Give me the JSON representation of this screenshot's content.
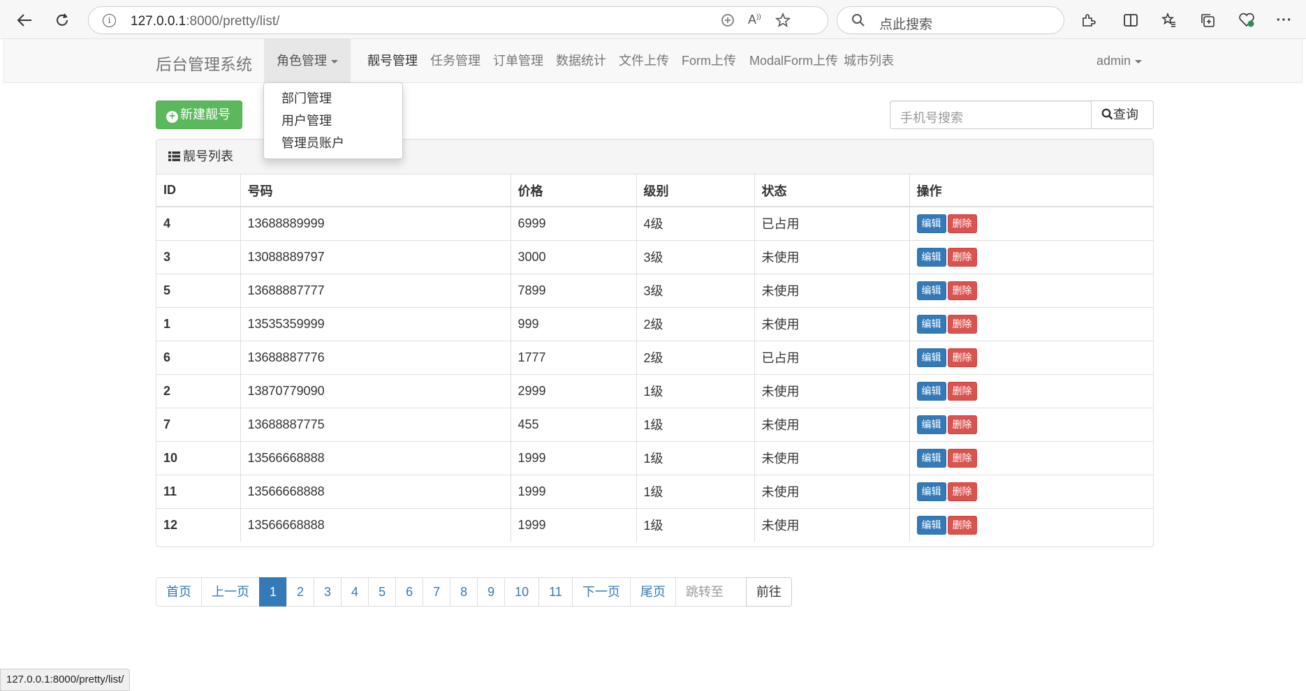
{
  "browser": {
    "url_host": "127.0.0.1",
    "url_rest": ":8000/pretty/list/",
    "search_placeholder": "点此搜索"
  },
  "navbar": {
    "brand": "后台管理系统",
    "items": [
      "角色管理",
      "靓号管理",
      "任务管理",
      "订单管理",
      "数据统计",
      "文件上传",
      "Form上传",
      "ModalForm上传",
      "城市列表"
    ],
    "user": "admin"
  },
  "dropdown": {
    "items": [
      "部门管理",
      "用户管理",
      "管理员账户"
    ]
  },
  "toolbar": {
    "new_button": "新建靓号",
    "search_placeholder": "手机号搜索",
    "search_button": "查询"
  },
  "panel": {
    "title": "靓号列表"
  },
  "table": {
    "headers": [
      "ID",
      "号码",
      "价格",
      "级别",
      "状态",
      "操作"
    ],
    "edit_label": "编辑",
    "delete_label": "删除",
    "rows": [
      [
        "4",
        "13688889999",
        "6999",
        "4级",
        "已占用"
      ],
      [
        "3",
        "13088889797",
        "3000",
        "3级",
        "未使用"
      ],
      [
        "5",
        "13688887777",
        "7899",
        "3级",
        "未使用"
      ],
      [
        "1",
        "13535359999",
        "999",
        "2级",
        "未使用"
      ],
      [
        "6",
        "13688887776",
        "1777",
        "2级",
        "已占用"
      ],
      [
        "2",
        "13870779090",
        "2999",
        "1级",
        "未使用"
      ],
      [
        "7",
        "13688887775",
        "455",
        "1级",
        "未使用"
      ],
      [
        "10",
        "13566668888",
        "1999",
        "1级",
        "未使用"
      ],
      [
        "11",
        "13566668888",
        "1999",
        "1级",
        "未使用"
      ],
      [
        "12",
        "13566668888",
        "1999",
        "1级",
        "未使用"
      ]
    ]
  },
  "pagination": {
    "first": "首页",
    "prev": "上一页",
    "pages": [
      "1",
      "2",
      "3",
      "4",
      "5",
      "6",
      "7",
      "8",
      "9",
      "10",
      "11"
    ],
    "current": "1",
    "next": "下一页",
    "last": "尾页",
    "jump_placeholder": "跳转至",
    "go": "前往"
  },
  "status_bar": "127.0.0.1:8000/pretty/list/",
  "colors": {
    "primary": "#337ab7",
    "success": "#5cb85c",
    "danger": "#d9534f"
  }
}
